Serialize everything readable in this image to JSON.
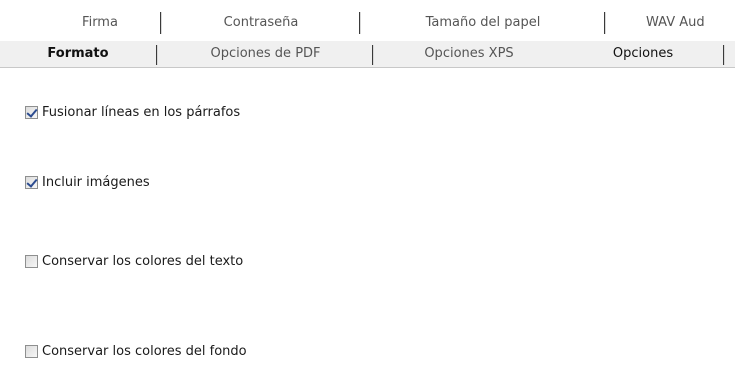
{
  "tabs": {
    "back_row": [
      {
        "label": "Firma"
      },
      {
        "label": "Contraseña"
      },
      {
        "label": "Tamaño del papel"
      },
      {
        "label": "WAV Aud"
      }
    ],
    "front_row": [
      {
        "label": "Formato"
      },
      {
        "label": "Opciones de PDF"
      },
      {
        "label": "Opciones XPS"
      },
      {
        "label": "Opciones",
        "selected": true
      }
    ]
  },
  "options": [
    {
      "label": "Fusionar líneas en los párrafos",
      "checked": true
    },
    {
      "label": "Incluir imágenes",
      "checked": true
    },
    {
      "label": "Conservar los colores del texto",
      "checked": false
    },
    {
      "label": "Conservar los colores del fondo",
      "checked": false
    }
  ],
  "colors": {
    "checkmark": "#2b4b8f",
    "tab_background": "#f0f0f0",
    "separator": "#3a3a3a"
  }
}
